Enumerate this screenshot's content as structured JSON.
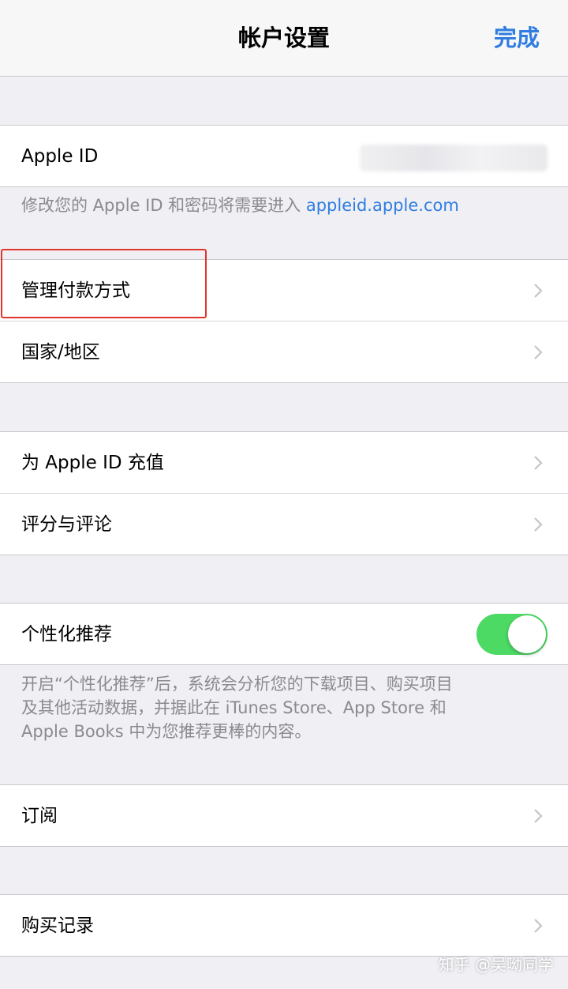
{
  "nav": {
    "title": "帐户设置",
    "done_label": "完成"
  },
  "apple_id_section": {
    "label": "Apple ID",
    "footer_text": "修改您的 Apple ID 和密码将需要进入 ",
    "footer_link": "appleid.apple.com"
  },
  "payment_section": {
    "manage_payment_label": "管理付款方式",
    "country_region_label": "国家/地区"
  },
  "balance_section": {
    "add_funds_label": "为 Apple ID 充值",
    "ratings_label": "评分与评论"
  },
  "personalization_section": {
    "label": "个性化推荐",
    "toggle_on": true,
    "footer_line1": "开启“个性化推荐”后，系统会分析您的下载项目、购买项目",
    "footer_line2": "及其他活动数据，并据此在 iTunes Store、App Store 和",
    "footer_line3": "Apple Books 中为您推荐更棒的内容。"
  },
  "subscriptions_section": {
    "label": "订阅"
  },
  "purchase_section": {
    "label": "购买记录"
  },
  "watermark": "知乎 @吴呦同学",
  "colors": {
    "accent": "#2f7de1",
    "toggle_on": "#4cd964",
    "highlight": "#e0352b",
    "background": "#efeff4"
  }
}
